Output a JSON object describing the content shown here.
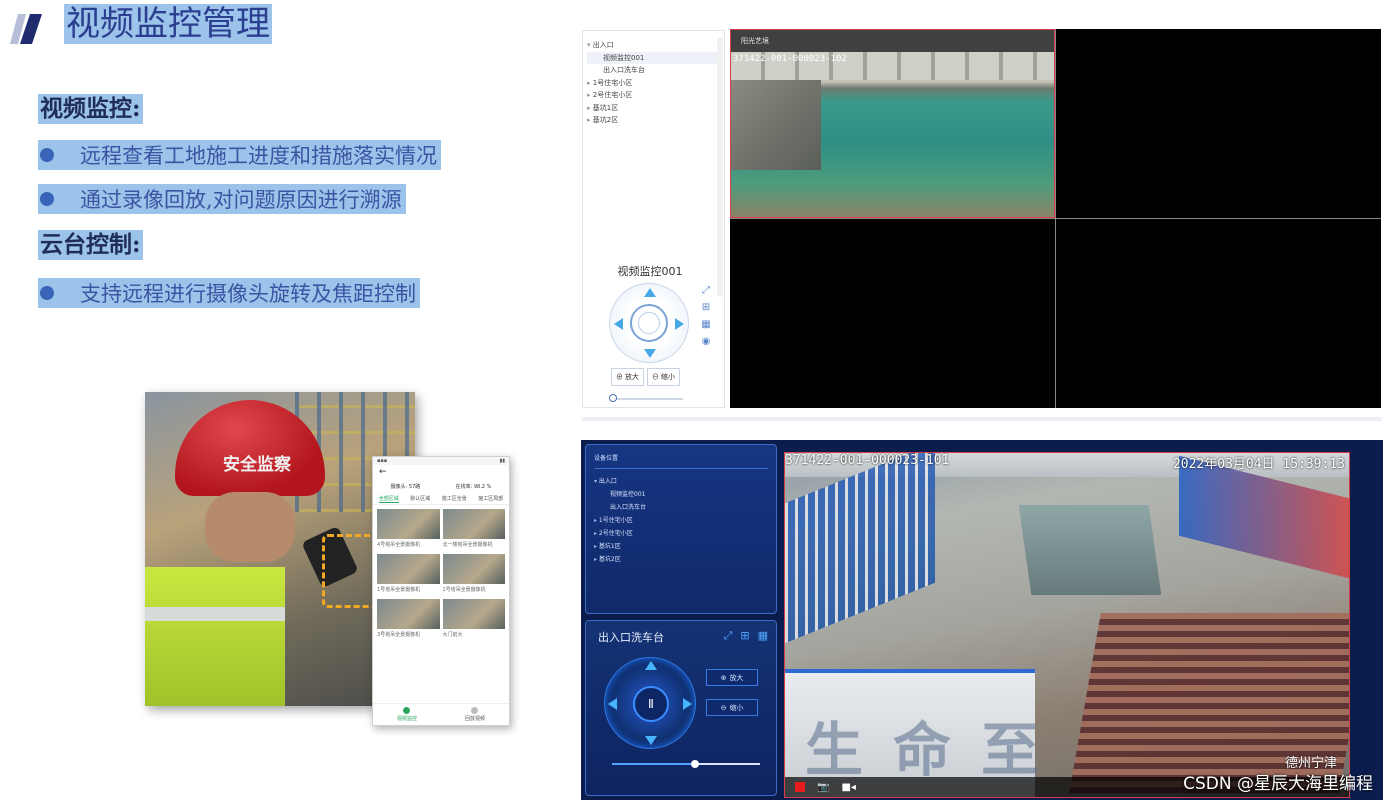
{
  "slide": {
    "title": "视频监控管理",
    "sections": [
      {
        "heading": "视频监控:",
        "bullets": [
          "远程查看工地施工进度和措施落实情况",
          "通过录像回放,对问题原因进行溯源"
        ]
      },
      {
        "heading": "云台控制:",
        "bullets": [
          "支持远程进行摄像头旋转及焦距控制"
        ]
      }
    ]
  },
  "photo": {
    "helmet_text": "安全监察"
  },
  "phone": {
    "stats": [
      "摄像头: 57路",
      "在线率: 98.2 %"
    ],
    "tabs": [
      "全部区域",
      "默认区域",
      "施工区全景",
      "施工区局部"
    ],
    "cameras": [
      "4号塔吊全景摄像机",
      "北一楼塔吊全景摄像机",
      "1号塔吊全景摄像机",
      "1号塔吊全景摄像机",
      "3号塔吊全景摄像机",
      "大门前大"
    ],
    "nav": [
      "视频监控",
      "回放视频"
    ]
  },
  "panel_top": {
    "tree": [
      {
        "label": "出入口",
        "level": 1,
        "open": true
      },
      {
        "label": "视频监控001",
        "level": 2,
        "selected": true
      },
      {
        "label": "出入口洗车台",
        "level": 2
      },
      {
        "label": "1号住宅小区",
        "level": 1
      },
      {
        "label": "2号住宅小区",
        "level": 1
      },
      {
        "label": "基坑1区",
        "level": 1
      },
      {
        "label": "基坑2区",
        "level": 1
      }
    ],
    "camera_name": "视频监控001",
    "zoom_in": "放大",
    "zoom_out": "缩小",
    "video_tile_title": "阳光艺境",
    "video_tile_osd": "371422-001-000023-102"
  },
  "panel_bottom": {
    "tree_title": "设备位置",
    "tree": [
      {
        "label": "出入口",
        "level": 1,
        "open": true
      },
      {
        "label": "视频监控001",
        "level": 2
      },
      {
        "label": "出入口洗车台",
        "level": 2
      },
      {
        "label": "1号住宅小区",
        "level": 1
      },
      {
        "label": "2号住宅小区",
        "level": 1
      },
      {
        "label": "基坑1区",
        "level": 1
      },
      {
        "label": "基坑2区",
        "level": 1
      }
    ],
    "camera_name": "出入口洗车台",
    "pause_symbol": "Ⅱ",
    "zoom_in": "放大",
    "zoom_out": "缩小",
    "osd_id": "371422-001-000023-101",
    "osd_time": "2022年03月04日 15:39:13",
    "osd_location": "德州宁津",
    "roof_text": "生命至",
    "slider_value": 0.56
  },
  "watermark": "CSDN @星辰大海里编程",
  "colors": {
    "title_blue": "#2c3e8f",
    "highlight": "#9cc3ea",
    "accent_blue": "#46a9e6",
    "dark_panel": "#0b1d4d",
    "record_red": "#e81c1c"
  }
}
